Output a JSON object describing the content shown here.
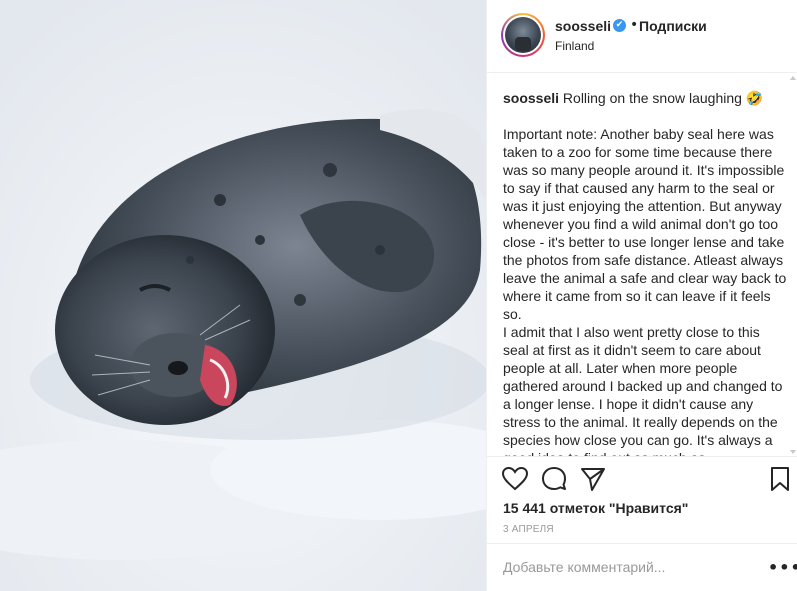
{
  "post": {
    "username": "soosseli",
    "verified_badge": "✔",
    "separator": "•",
    "follow_label": "Подписки",
    "location": "Finland"
  },
  "caption": {
    "username": "soosseli",
    "title": "Rolling on the snow laughing 🤣",
    "body": "Important note: Another baby seal here was taken to a zoo for some time because there was so many people around it. It's impossible to say if that caused any harm to the seal or was it just enjoying the attention. But anyway whenever you find a wild animal don't go too close - it's better to use longer lense and take the photos from safe distance. Atleast always leave the animal a safe and clear way back to where it came from so it can leave if it feels so.\nI admit that I also went pretty close to this seal at first as it didn't seem to care about people at all. Later when more people gathered around I backed up and changed to a longer lense. I hope it didn't cause any stress to the animal. It really depends on the species how close you can go. It's always a good idea to find out as much as"
  },
  "actions": {
    "like_icon": "heart-icon",
    "comment_icon": "comment-icon",
    "share_icon": "share-icon",
    "save_icon": "bookmark-icon",
    "likes_text": "15 441 отметок \"Нравится\"",
    "date": "3 АПРЕЛЯ"
  },
  "comment": {
    "placeholder": "Добавьте комментарий...",
    "more_label": "•••"
  },
  "colors": {
    "verified": "#3897f0",
    "text": "#262626",
    "muted": "#999999",
    "border": "#efefef"
  }
}
